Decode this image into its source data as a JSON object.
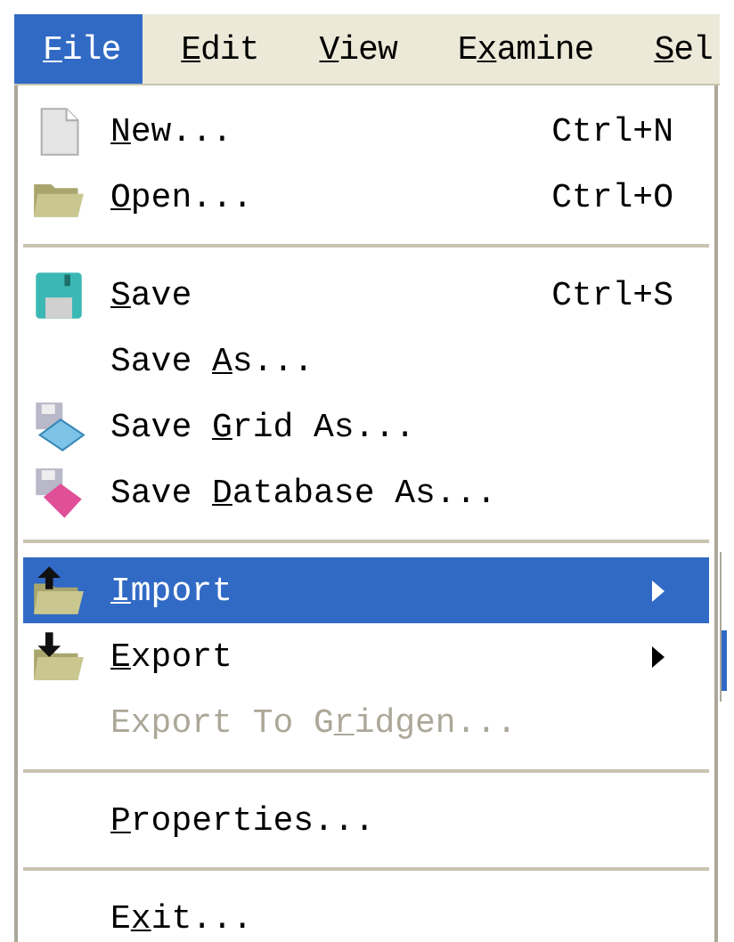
{
  "menu_bar": [
    {
      "label": {
        "key": "F",
        "post": "ile"
      },
      "selected": true
    },
    {
      "label": {
        "key": "E",
        "post": "dit"
      },
      "selected": false
    },
    {
      "label": {
        "key": "V",
        "post": "iew"
      },
      "selected": false
    },
    {
      "label": {
        "pre": "E",
        "key": "x",
        "post": "amine"
      },
      "selected": false
    },
    {
      "label": {
        "key": "S",
        "post": "el"
      },
      "selected": false
    }
  ],
  "file_menu": [
    {
      "kind": "document",
      "label": {
        "key": "N",
        "post": "ew..."
      },
      "shortcut": "Ctrl+N",
      "highlighted": false,
      "disabled": false,
      "submenu": false
    },
    {
      "kind": "folder",
      "label": {
        "key": "O",
        "post": "pen..."
      },
      "shortcut": "Ctrl+O",
      "highlighted": false,
      "disabled": false,
      "submenu": false
    },
    {
      "kind": "separator"
    },
    {
      "kind": "floppy",
      "label": {
        "key": "S",
        "post": "ave"
      },
      "shortcut": "Ctrl+S",
      "highlighted": false,
      "disabled": false,
      "submenu": false
    },
    {
      "kind": "plain",
      "label": {
        "pre": "Save ",
        "key": "A",
        "post": "s..."
      },
      "highlighted": false,
      "disabled": false,
      "submenu": false
    },
    {
      "kind": "grid",
      "label": {
        "pre": "Save ",
        "key": "G",
        "post": "rid As..."
      },
      "highlighted": false,
      "disabled": false,
      "submenu": false
    },
    {
      "kind": "database",
      "label": {
        "pre": "Save ",
        "key": "D",
        "post": "atabase As..."
      },
      "highlighted": false,
      "disabled": false,
      "submenu": false
    },
    {
      "kind": "separator"
    },
    {
      "kind": "import",
      "label": {
        "key": "I",
        "post": "mport"
      },
      "highlighted": true,
      "disabled": false,
      "submenu": true
    },
    {
      "kind": "export",
      "label": {
        "key": "E",
        "post": "xport"
      },
      "highlighted": false,
      "disabled": false,
      "submenu": true
    },
    {
      "kind": "plain",
      "label": {
        "pre": "Export To G",
        "key": "r",
        "post": "idgen..."
      },
      "highlighted": false,
      "disabled": true,
      "submenu": false
    },
    {
      "kind": "separator"
    },
    {
      "kind": "plain",
      "label": {
        "key": "P",
        "post": "roperties..."
      },
      "highlighted": false,
      "disabled": false,
      "submenu": false
    },
    {
      "kind": "separator"
    },
    {
      "kind": "plain",
      "label": {
        "pre": "E",
        "key": "x",
        "post": "it..."
      },
      "highlighted": false,
      "disabled": false,
      "submenu": false
    }
  ]
}
